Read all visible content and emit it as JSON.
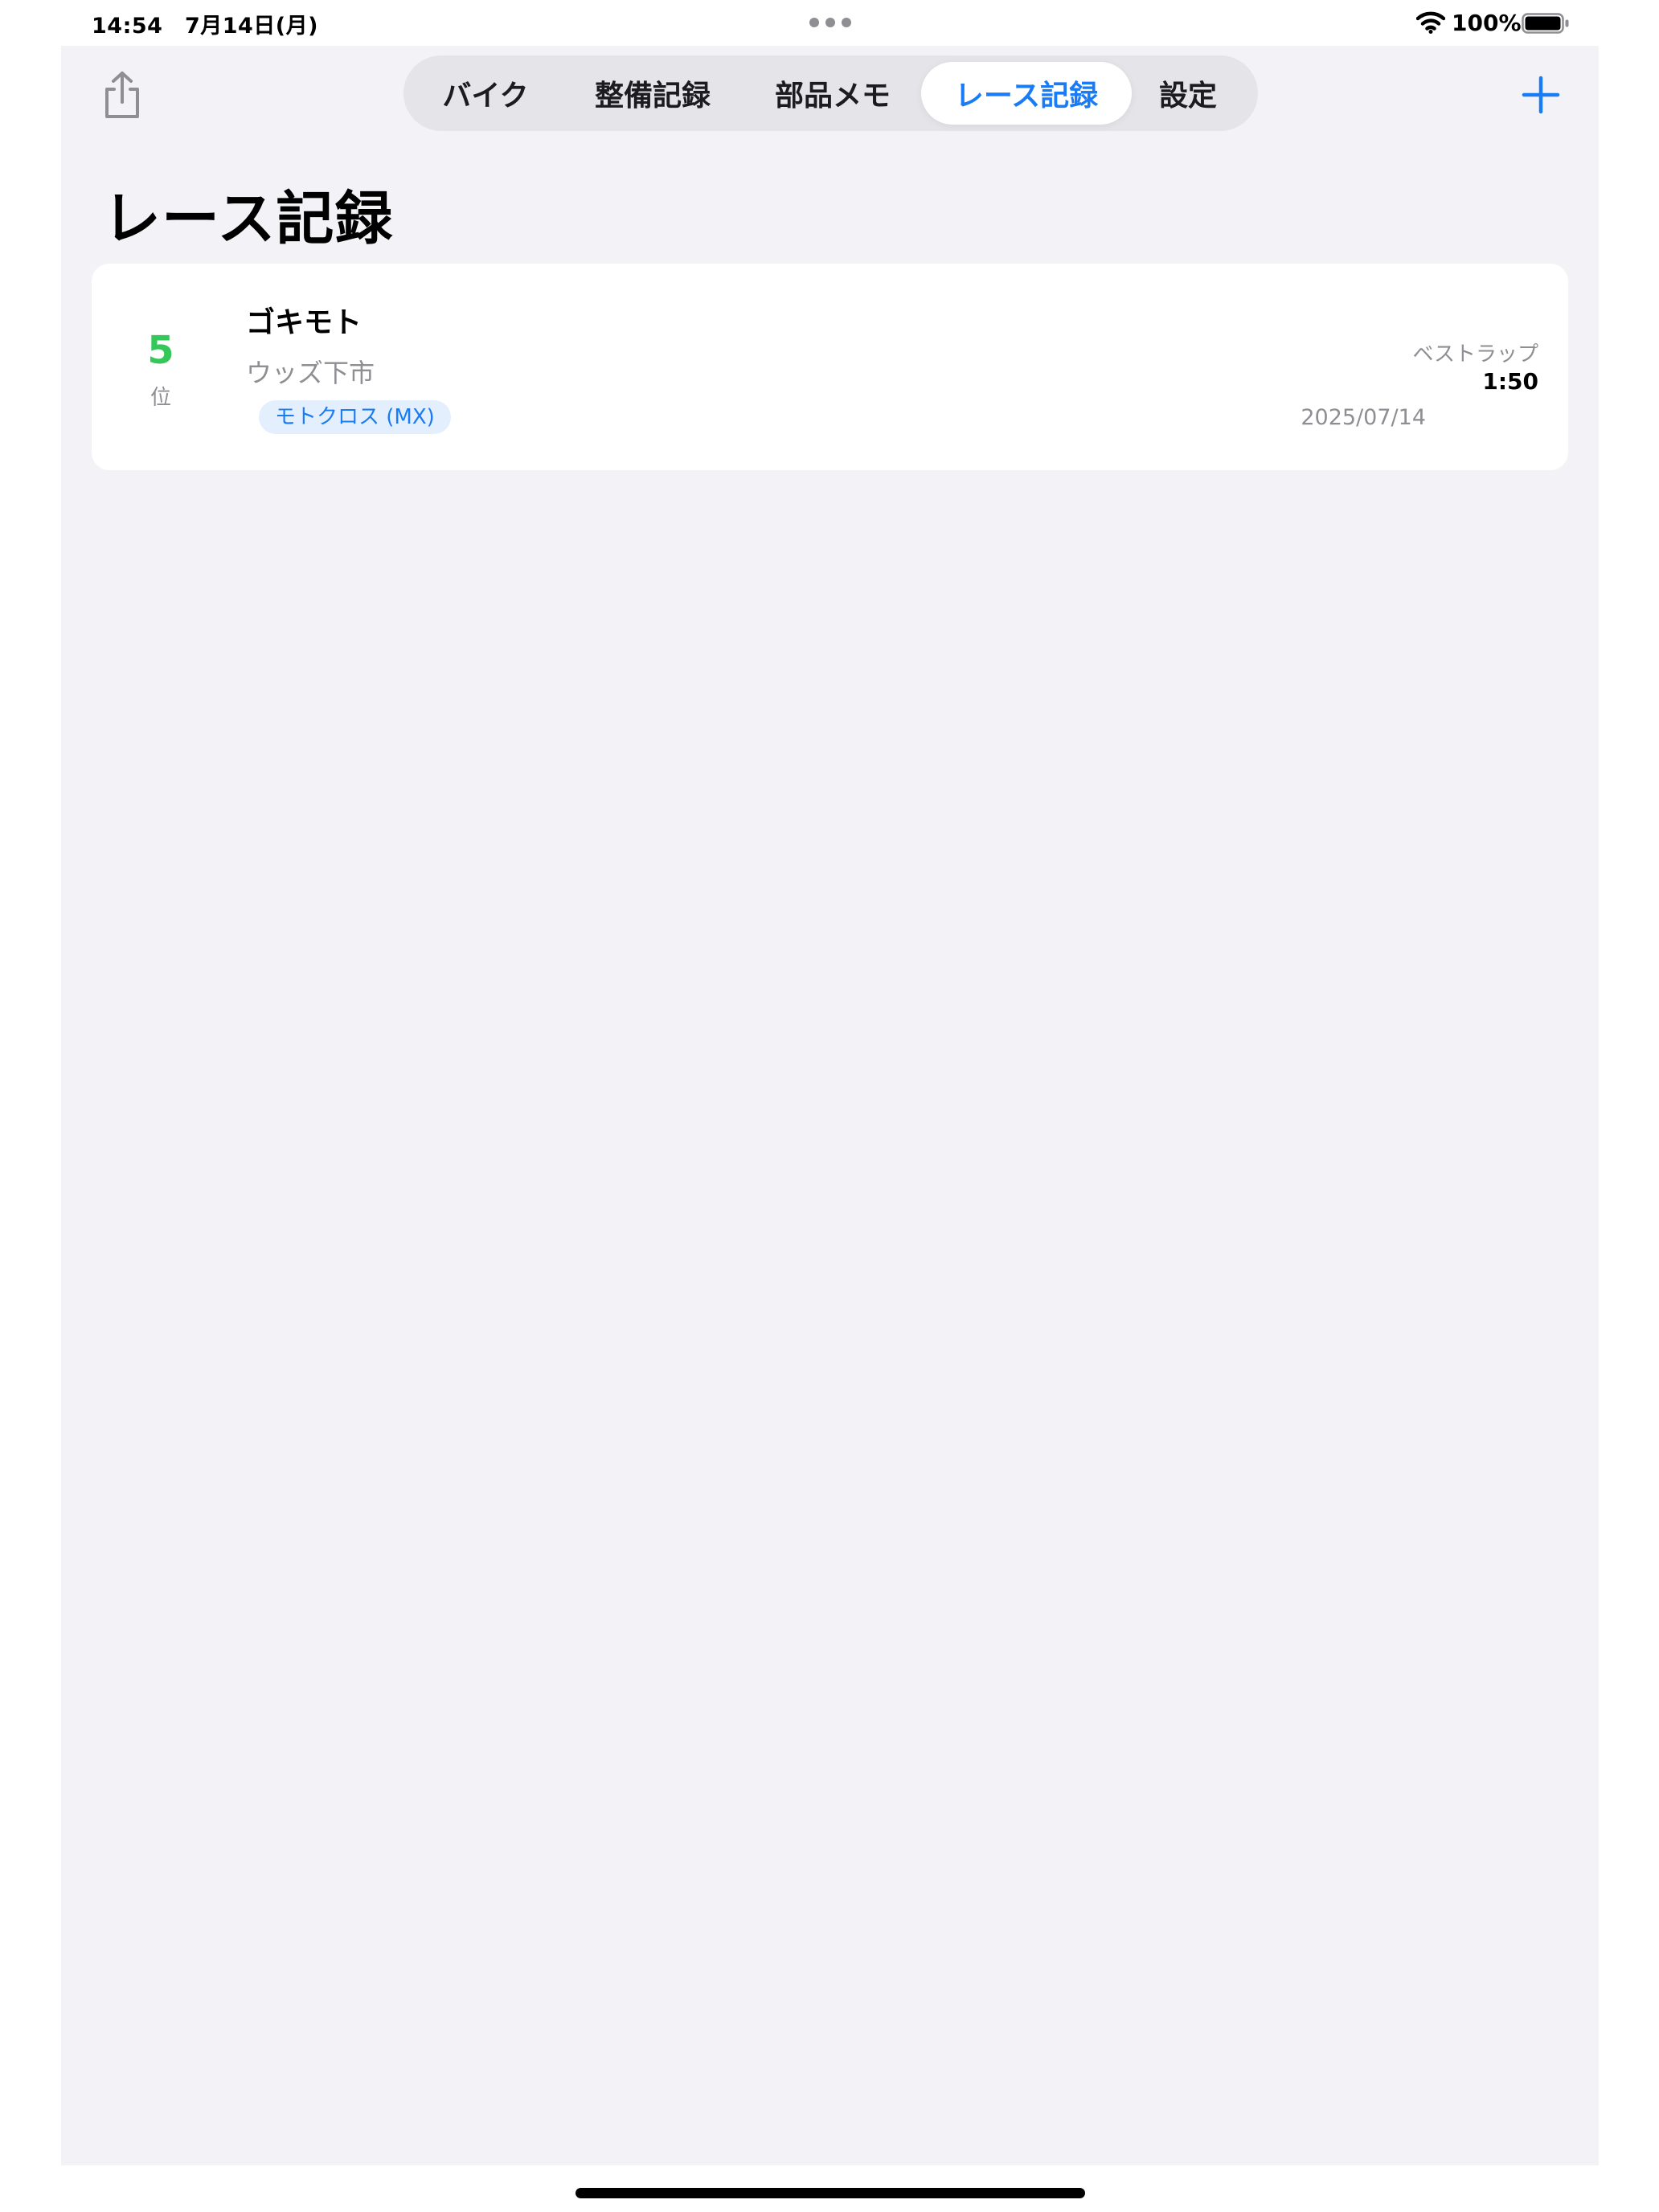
{
  "status_bar": {
    "time_date": "14:54　7月14日(月)",
    "battery_percent": "100%",
    "battery_level": 1.0,
    "icons": [
      "multitask-dots-icon",
      "wifi-icon",
      "battery-icon"
    ]
  },
  "toolbar": {
    "share_icon": "share-icon",
    "add_icon": "plus-icon"
  },
  "tabs": [
    {
      "label": "バイク",
      "active": false
    },
    {
      "label": "整備記録",
      "active": false
    },
    {
      "label": "部品メモ",
      "active": false
    },
    {
      "label": "レース記録",
      "active": true
    },
    {
      "label": "設定",
      "active": false
    }
  ],
  "page": {
    "title": "レース記録"
  },
  "races": [
    {
      "rank": "5",
      "rank_unit": "位",
      "name": "ゴキモト",
      "venue": "ウッズ下市",
      "category": "モトクロス (MX)",
      "date": "2025/07/14",
      "best_lap_label": "ベストラップ",
      "best_lap": "1:50"
    }
  ],
  "colors": {
    "accent": "#1a7cf5",
    "rank_green": "#34c759",
    "background": "#f2f2f7",
    "card": "#ffffff",
    "secondary_text": "#8e8e93",
    "tag_background": "#e3effd"
  }
}
